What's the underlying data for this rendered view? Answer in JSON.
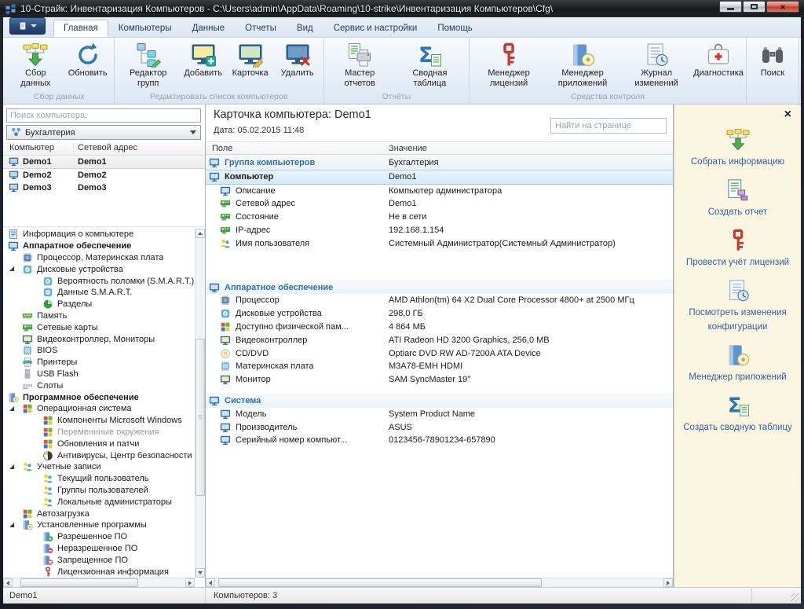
{
  "colors": {
    "accent_blue": "#2e75b6",
    "titlebar_bg": "#1d1f24",
    "ribbon_bg": "#e7eff8",
    "sidebar_bg": "#fbf6e1",
    "selection_blue": "#d4e9f9",
    "link_blue": "#2f6fae",
    "key_red": "#c23b2e",
    "close_button_red": "#bb3a28"
  },
  "window": {
    "title": "10-Страйк: Инвентаризация Компьютеров - C:\\Users\\admin\\AppData\\Roaming\\10-strike\\Инвентаризация Компьютеров\\Cfg\\",
    "close_glyph": "×"
  },
  "menu_tabs": [
    {
      "label": "Главная",
      "active": "true"
    },
    {
      "label": "Компьютеры"
    },
    {
      "label": "Данные"
    },
    {
      "label": "Отчеты"
    },
    {
      "label": "Вид"
    },
    {
      "label": "Сервис и настройки"
    },
    {
      "label": "Помощь"
    }
  ],
  "ribbon": {
    "groups": [
      {
        "label": "Сбор данных",
        "buttons": [
          {
            "label": "Сбор данных",
            "icon": "rcollect"
          },
          {
            "label": "Обновить",
            "icon": "rrefresh"
          }
        ]
      },
      {
        "label": "Редактировать список компьютеров",
        "buttons": [
          {
            "label": "Редактор групп",
            "icon": "rgroups"
          },
          {
            "label": "Добавить",
            "icon": "radd"
          },
          {
            "label": "Карточка",
            "icon": "rcard"
          },
          {
            "label": "Удалить",
            "icon": "rdel"
          }
        ]
      },
      {
        "label": "Отчёты",
        "buttons": [
          {
            "label": "Мастер отчетов",
            "icon": "rreport"
          },
          {
            "label": "Сводная таблица",
            "icon": "rpivot"
          }
        ]
      },
      {
        "label": "Средства контроля",
        "buttons": [
          {
            "label": "Менеджер лицензий",
            "icon": "rkey"
          },
          {
            "label": "Менеджер приложений",
            "icon": "rapp"
          },
          {
            "label": "Журнал изменений",
            "icon": "rlog"
          },
          {
            "label": "Диагностика",
            "icon": "rdiag"
          }
        ]
      },
      {
        "label": "",
        "buttons": [
          {
            "label": "Поиск",
            "icon": "rsearch"
          }
        ]
      }
    ]
  },
  "left": {
    "search_placeholder": "Поиск компьютера:",
    "group": "Бухгалтерия",
    "columns": [
      "Компьютер",
      "Сетевой адрес"
    ],
    "computers": [
      {
        "name": "Demo1",
        "addr": "Demo1",
        "style": "selected"
      },
      {
        "name": "Demo2",
        "addr": "Demo2"
      },
      {
        "name": "Demo3",
        "addr": "Demo3"
      }
    ],
    "tree": [
      {
        "label": "Информация о компьютере",
        "icon": "info",
        "lvl": "0"
      },
      {
        "label": "Аппаратное обеспечение",
        "icon": "monb",
        "lvl": "0",
        "style": "bold"
      },
      {
        "label": "Процессор, Материнская плата",
        "icon": "chip",
        "lvl": "1"
      },
      {
        "label": "Дисковые устройства",
        "icon": "disk",
        "lvl": "1",
        "exp": "true"
      },
      {
        "label": "Вероятность поломки (S.M.A.R.T.)",
        "icon": "disk",
        "lvl": "2"
      },
      {
        "label": "Данные S.M.A.R.T.",
        "icon": "disk",
        "lvl": "2"
      },
      {
        "label": "Разделы",
        "icon": "pie",
        "lvl": "2"
      },
      {
        "label": "Память",
        "icon": "ram",
        "lvl": "1"
      },
      {
        "label": "Сетевые карты",
        "icon": "net",
        "lvl": "1"
      },
      {
        "label": "Видеоконтроллер, Мониторы",
        "icon": "mony",
        "lvl": "1"
      },
      {
        "label": "BIOS",
        "icon": "bios",
        "lvl": "1"
      },
      {
        "label": "Принтеры",
        "icon": "prn",
        "lvl": "1"
      },
      {
        "label": "USB Flash",
        "icon": "usb",
        "lvl": "1"
      },
      {
        "label": "Слоты",
        "icon": "slot",
        "lvl": "1"
      },
      {
        "label": "Программное обеспечение",
        "icon": "soft",
        "lvl": "0",
        "style": "bold"
      },
      {
        "label": "Операционная система",
        "icon": "win",
        "lvl": "1",
        "exp": "true"
      },
      {
        "label": "Компоненты Microsoft Windows",
        "icon": "win",
        "lvl": "2"
      },
      {
        "label": "Переменнные окружения",
        "icon": "win",
        "lvl": "2",
        "style": "gray"
      },
      {
        "label": "Обновления и патчи",
        "icon": "win",
        "lvl": "2"
      },
      {
        "label": "Антивирусы, Центр безопасности",
        "icon": "av",
        "lvl": "2"
      },
      {
        "label": "Учетные записи",
        "icon": "usr",
        "lvl": "1",
        "exp": "true"
      },
      {
        "label": "Текущий пользователь",
        "icon": "usr",
        "lvl": "2"
      },
      {
        "label": "Группы пользователей",
        "icon": "usr",
        "lvl": "2"
      },
      {
        "label": "Локальные администраторы",
        "icon": "usr",
        "lvl": "2"
      },
      {
        "label": "Автозагрузка",
        "icon": "win",
        "lvl": "1"
      },
      {
        "label": "Установленные программы",
        "icon": "soft",
        "lvl": "1",
        "exp": "true"
      },
      {
        "label": "Разрешенное ПО",
        "icon": "softok",
        "lvl": "2"
      },
      {
        "label": "Неразрешенное ПО",
        "icon": "softwarn",
        "lvl": "2"
      },
      {
        "label": "Запрещенное ПО",
        "icon": "softblock",
        "lvl": "2"
      },
      {
        "label": "Лицензионная информация",
        "icon": "key",
        "lvl": "2"
      }
    ]
  },
  "card": {
    "title": "Карточка компьютера: Demo1",
    "date": "Дата: 05.02.2015 11:48",
    "find_placeholder": "Найти на странице",
    "columns": [
      "Поле",
      "Значение"
    ],
    "rows": [
      {
        "type": "group",
        "icon": "monb",
        "label": "Группа компьютеров",
        "value": "Бухгалтерия"
      },
      {
        "type": "selected",
        "icon": "monb",
        "label": "Компьютер",
        "value": "Demo1"
      },
      {
        "icon": "monb",
        "label": "Описание",
        "value": "Компьютер администратора"
      },
      {
        "icon": "net",
        "label": "Сетевой адрес",
        "value": "Demo1"
      },
      {
        "icon": "net",
        "label": "Состояние",
        "value": "Не в сети"
      },
      {
        "icon": "net",
        "label": "IP-адрес",
        "value": "192.168.1.154"
      },
      {
        "icon": "usr",
        "label": "Имя пользователя",
        "value": "Системный Администратор(Системный Администратор)"
      },
      {
        "type": "spacer-lg"
      },
      {
        "type": "group",
        "icon": "monb",
        "label": "Аппаратное обеспечение",
        "value": ""
      },
      {
        "icon": "chip",
        "label": "Процессор",
        "value": "AMD Athlon(tm) 64 X2 Dual Core Processor 4800+ at 2500 МГц"
      },
      {
        "icon": "disk",
        "label": "Дисковые устройства",
        "value": "298,0 ГБ"
      },
      {
        "icon": "win",
        "label": "Доступно физической пам...",
        "value": "4 864 МБ"
      },
      {
        "icon": "mony",
        "label": "Видеоконтроллер",
        "value": "ATI Radeon HD 3200 Graphics, 256,0 MB"
      },
      {
        "icon": "cd",
        "label": "CD/DVD",
        "value": "Optiarc DVD RW AD-7200A ATA Device"
      },
      {
        "icon": "bios",
        "label": "Материнская плата",
        "value": "M3A78-EMH HDMI"
      },
      {
        "icon": "mony",
        "label": "Монитор",
        "value": "SAM SyncMaster 19''"
      },
      {
        "type": "spacer-sm"
      },
      {
        "type": "group",
        "icon": "monb",
        "label": "Система",
        "value": ""
      },
      {
        "icon": "monb",
        "label": "Модель",
        "value": "System Product Name"
      },
      {
        "icon": "monb",
        "label": "Производитель",
        "value": "ASUS"
      },
      {
        "icon": "monb",
        "label": "Серийный номер компьют...",
        "value": "0123456-78901234-657890"
      }
    ]
  },
  "sidebar": {
    "close_glyph": "×",
    "actions": [
      {
        "label": "Собрать информацию",
        "icon": "rcollect"
      },
      {
        "label": "Создать отчет",
        "icon": "sreport"
      },
      {
        "label": "Провести учёт лицензий",
        "icon": "rkey"
      },
      {
        "label": "Посмотреть изменения конфигурации",
        "icon": "rlog"
      },
      {
        "label": "Менеджер приложений",
        "icon": "rapp"
      },
      {
        "label": "Создать сводную таблицу",
        "icon": "rpivot"
      }
    ]
  },
  "status": {
    "selected": "Demo1",
    "count": "Компьютеров: 3"
  }
}
